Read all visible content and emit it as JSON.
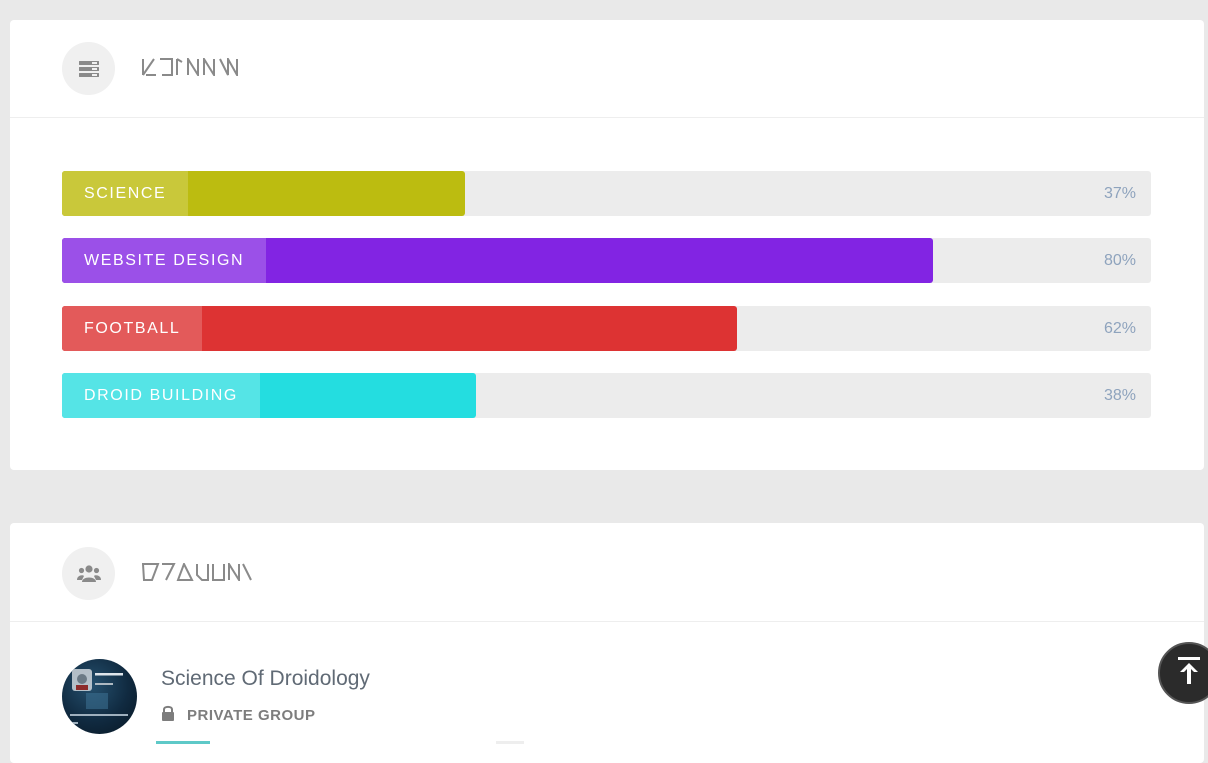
{
  "skills_card": {
    "icon": "list-icon",
    "title_aurebesh": "skills",
    "items": [
      {
        "label": "SCIENCE",
        "percent": 37,
        "percent_text": "37%",
        "color": "#bcbc10",
        "label_bg": "#c9c83a"
      },
      {
        "label": "WEBSITE DESIGN",
        "percent": 80,
        "percent_text": "80%",
        "color": "#8224e3",
        "label_bg": "#9b50e8"
      },
      {
        "label": "FOOTBALL",
        "percent": 62,
        "percent_text": "62%",
        "color": "#dd3333",
        "label_bg": "#e35a5a"
      },
      {
        "label": "DROID BUILDING",
        "percent": 38,
        "percent_text": "38%",
        "color": "#24dde0",
        "label_bg": "#55e4e6"
      }
    ]
  },
  "groups_card": {
    "icon": "users-icon",
    "title_aurebesh": "groups",
    "items": [
      {
        "name": "Science Of Droidology",
        "privacy": "PRIVATE GROUP",
        "privacy_icon": "lock-icon",
        "avatar_text": {
          "user": "Iris_Droid",
          "action": "Sign Out",
          "email": "droidology@alliancedroi...",
          "line2": "eu"
        }
      }
    ]
  },
  "scroll_top": {
    "icon": "arrow-up-to-line-icon"
  }
}
